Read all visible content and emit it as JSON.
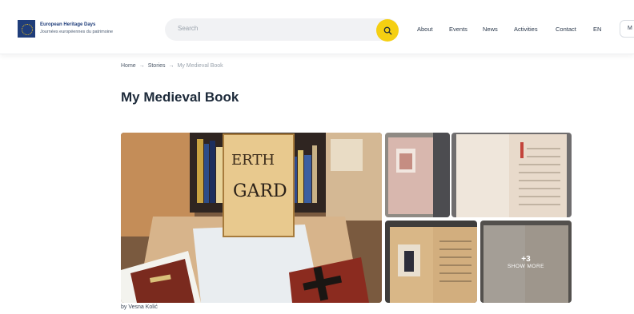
{
  "header": {
    "logo_title": "European Heritage Days",
    "logo_subtitle": "Journées européennes du patrimoine",
    "search_placeholder": "Search",
    "nav": [
      "About",
      "Events",
      "News",
      "Activities",
      "Contact",
      "EN"
    ],
    "lang_chip": "M"
  },
  "breadcrumb": [
    "Home",
    "Stories",
    "My Medieval Book"
  ],
  "page_title": "My Medieval Book",
  "gallery": {
    "more_count": "+3",
    "more_label": "SHOW MORE",
    "caption": "by Vesna Kolić"
  }
}
